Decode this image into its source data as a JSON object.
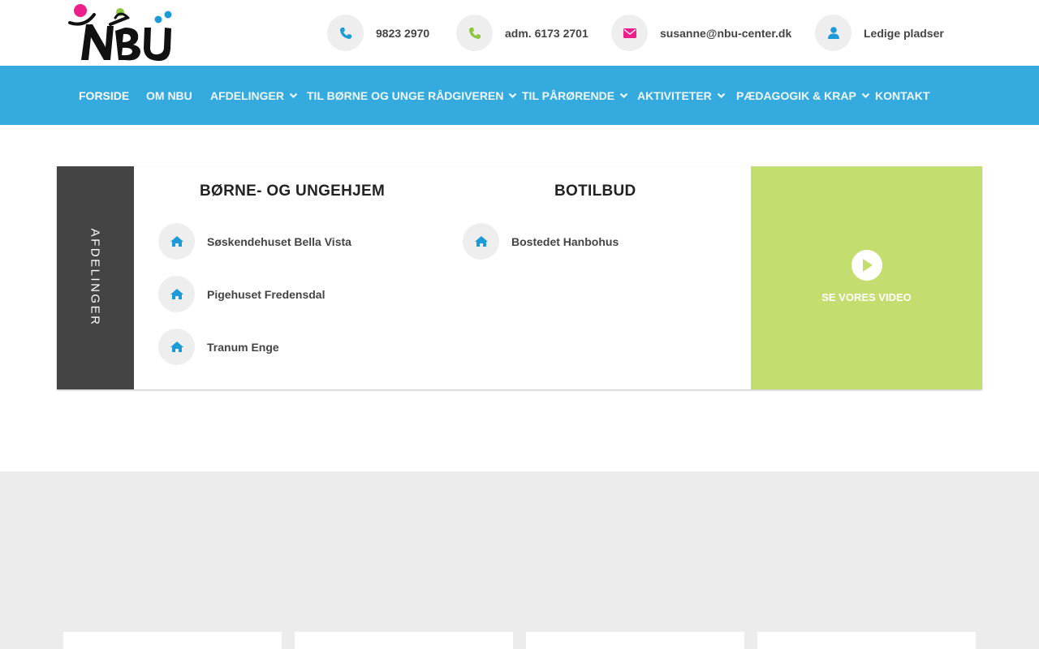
{
  "logo": {
    "text": "NBU",
    "colors": {
      "pink": "#ec1e8c",
      "green": "#8cc63f",
      "blue": "#1e9ad6",
      "black": "#111111"
    }
  },
  "contacts": [
    {
      "icon": "phone-icon",
      "text": "9823 2970",
      "color": "#1e9ad6"
    },
    {
      "icon": "phone-icon",
      "text": "adm. 6173 2701",
      "color": "#8cc63f"
    },
    {
      "icon": "envelope-icon",
      "text": "susanne@nbu-center.dk",
      "color": "#ec1e8c"
    },
    {
      "icon": "user-icon",
      "text": "Ledige pladser",
      "color": "#1e9ad6"
    }
  ],
  "nav": {
    "items": [
      {
        "label": "FORSIDE",
        "dropdown": false,
        "active": true
      },
      {
        "label": "OM NBU",
        "dropdown": false
      },
      {
        "label": "AFDELINGER",
        "dropdown": true
      },
      {
        "label": "TIL BØRNE OG UNGE RÅDGIVEREN",
        "dropdown": true
      },
      {
        "label": "TIL PÅRØRENDE",
        "dropdown": true
      },
      {
        "label": "AKTIVITETER",
        "dropdown": true
      },
      {
        "label": "PÆDAGOGIK & KRAP",
        "dropdown": true
      },
      {
        "label": "KONTAKT",
        "dropdown": false
      }
    ],
    "color": "#35aadf"
  },
  "panel": {
    "side_label": "AFDELINGER",
    "columns": [
      {
        "title": "BØRNE- OG UNGEHJEM",
        "items": [
          "Søskendehuset Bella Vista",
          "Pigehuset Fredensdal",
          "Tranum Enge"
        ]
      },
      {
        "title": "BOTILBUD",
        "items": [
          "Bostedet Hanbohus"
        ]
      }
    ],
    "item_icon": "home-icon",
    "video": {
      "label": "SE VORES VIDEO",
      "icon": "play-icon",
      "color": "#c3de6e"
    }
  }
}
